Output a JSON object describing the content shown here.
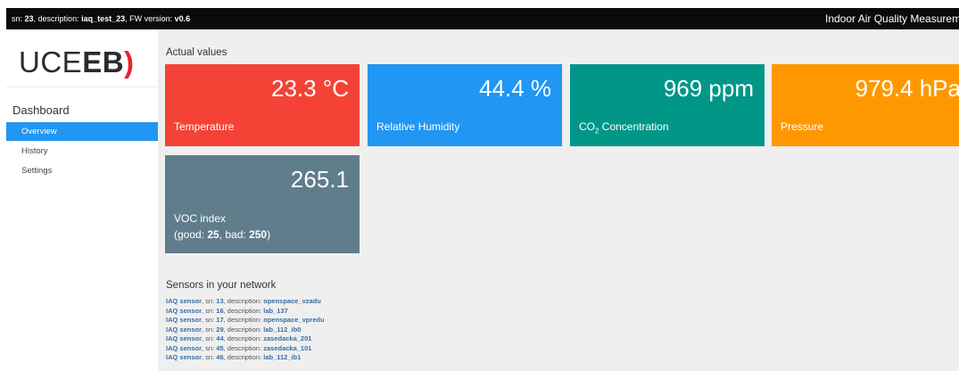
{
  "topbar": {
    "sn_prefix": "sn:",
    "sn": "23",
    "desc_prefix": ", description:",
    "description": "iaq_test_23",
    "fw_prefix": ", FW version:",
    "fw": "v0.6",
    "title": "Indoor Air Quality Measuremer"
  },
  "sidebar": {
    "logo": {
      "part1": "UCE",
      "part2": "EB",
      "bracket": ")"
    },
    "section": "Dashboard",
    "items": [
      {
        "label": "Overview",
        "active": true
      },
      {
        "label": "History",
        "active": false
      },
      {
        "label": "Settings",
        "active": false
      }
    ]
  },
  "main": {
    "actual_title": "Actual values",
    "cards": [
      {
        "value": "23.3 °C",
        "label": "Temperature",
        "color": "#f44336"
      },
      {
        "value": "44.4 %",
        "label": "Relative Humidity",
        "color": "#2196f3"
      },
      {
        "value": "969 ppm",
        "label_main": "CO",
        "label_sub": "2",
        "label_rest": " Concentration",
        "color": "#009688"
      },
      {
        "value": "979.4 hPa",
        "label": "Pressure",
        "color": "#ff9800"
      }
    ],
    "voc": {
      "value": "265.1",
      "label": "VOC index",
      "good_prefix": "(good: ",
      "good": "25",
      "bad_prefix": ", bad: ",
      "bad": "250",
      "suffix": ")",
      "color": "#607d8b"
    },
    "sensors_title": "Sensors in your network",
    "sensors": [
      {
        "type": "IAQ sensor",
        "sn": "13",
        "description": "openspace_vzadu"
      },
      {
        "type": "IAQ sensor",
        "sn": "16",
        "description": "lab_137"
      },
      {
        "type": "IAQ sensor",
        "sn": "17",
        "description": "openspace_vpredu"
      },
      {
        "type": "IAQ sensor",
        "sn": "29",
        "description": "lab_112_ib0"
      },
      {
        "type": "IAQ sensor",
        "sn": "44",
        "description": "zasedacka_201"
      },
      {
        "type": "IAQ sensor",
        "sn": "45",
        "description": "zasedacka_101"
      },
      {
        "type": "IAQ sensor",
        "sn": "46",
        "description": "lab_112_ib1"
      }
    ],
    "sensor_sn_prefix": ", sn: ",
    "sensor_desc_prefix": ", description: "
  }
}
